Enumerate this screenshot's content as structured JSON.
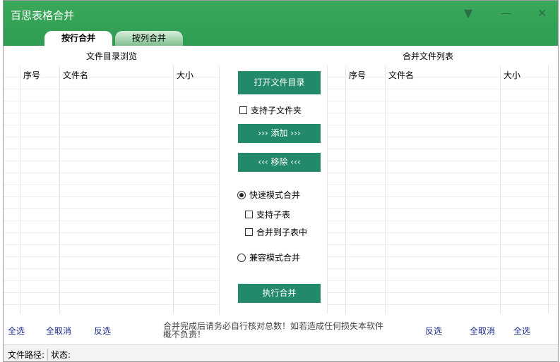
{
  "window": {
    "title": "百思表格合并"
  },
  "tabs": [
    {
      "label": "按行合并"
    },
    {
      "label": "按列合并"
    }
  ],
  "left": {
    "caption": "文件目录浏览",
    "columns": [
      "序号",
      "文件名",
      "大小"
    ]
  },
  "right": {
    "caption": "合并文件列表",
    "columns": [
      "序号",
      "文件名",
      "大小"
    ]
  },
  "center": {
    "open_dir": "打开文件目录",
    "include_subfolders": "支持子文件夹",
    "add": "››› 添加 ›››",
    "remove": "‹‹‹ 移除 ‹‹‹",
    "fast_mode": "快速模式合并",
    "support_subsheet": "支持子表",
    "merge_into_subsheet": "合并到子表中",
    "compat_mode": "兼容模式合并",
    "run": "执行合并"
  },
  "bottom": {
    "left_links": [
      "全选",
      "全取消",
      "反选"
    ],
    "right_links": [
      "反选",
      "全取消",
      "全选"
    ],
    "note": "合并完成后请务必自行核对总数！如若造成任何损失本软件概不负责！"
  },
  "status": {
    "path_label": "文件路径:",
    "state_label": "状态:"
  }
}
